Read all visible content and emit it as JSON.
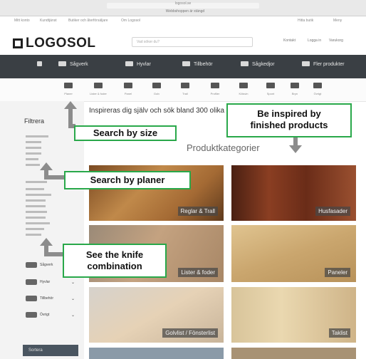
{
  "browser": {
    "url": "logosol.se",
    "notice": "Webbshoppen är stängd"
  },
  "topbar": {
    "left_items": [
      "Mitt konto",
      "Kundtjänst",
      "Butiker och återförsäljare",
      "Om Logosol"
    ],
    "right_items": [
      "Hitta butik",
      "Meny"
    ]
  },
  "header": {
    "logo": "LOGOSOL",
    "search_placeholder": "Vad söker du?",
    "right_items": [
      "Kontakt",
      "Logga in",
      "Varukorg"
    ]
  },
  "nav": {
    "items": [
      "",
      "Sågverk",
      "Hyvlar",
      "Tillbehör",
      "Sågkedjor",
      "Fler produkter"
    ]
  },
  "categories": {
    "labels": [
      "Planer",
      "Lister & foder",
      "Panel",
      "Golv",
      "Trall",
      "Profiler",
      "Kölsvin",
      "Spont",
      "Bryn",
      "Övrigt"
    ]
  },
  "sidebar": {
    "title": "Filtrera",
    "item_labels": [
      "Sågverk",
      "Hyvlar",
      "Tillbehör",
      "Övrigt"
    ],
    "button_label": "Sortera"
  },
  "intro": {
    "text": "Inspireras dig själv och sök bland 300 olika kniv"
  },
  "section": {
    "title": "Produktkategorier"
  },
  "tiles": [
    {
      "label": "Reglar & Trall"
    },
    {
      "label": "Husfasader"
    },
    {
      "label": "Lister & foder"
    },
    {
      "label": "Paneler"
    },
    {
      "label": "Golvlist / Fönsterlist"
    },
    {
      "label": "Taklist"
    }
  ],
  "callouts": {
    "search_by_size": "Search by size",
    "inspired_line1": "Be inspired by",
    "inspired_line2": "finished products",
    "search_by_planer": "Search by planer",
    "knife_line1": "See the knife",
    "knife_line2": "combination"
  },
  "colors": {
    "callout_border": "#29a84a",
    "nav_bg": "#3a3f44",
    "arrow": "#8c8c8c"
  }
}
